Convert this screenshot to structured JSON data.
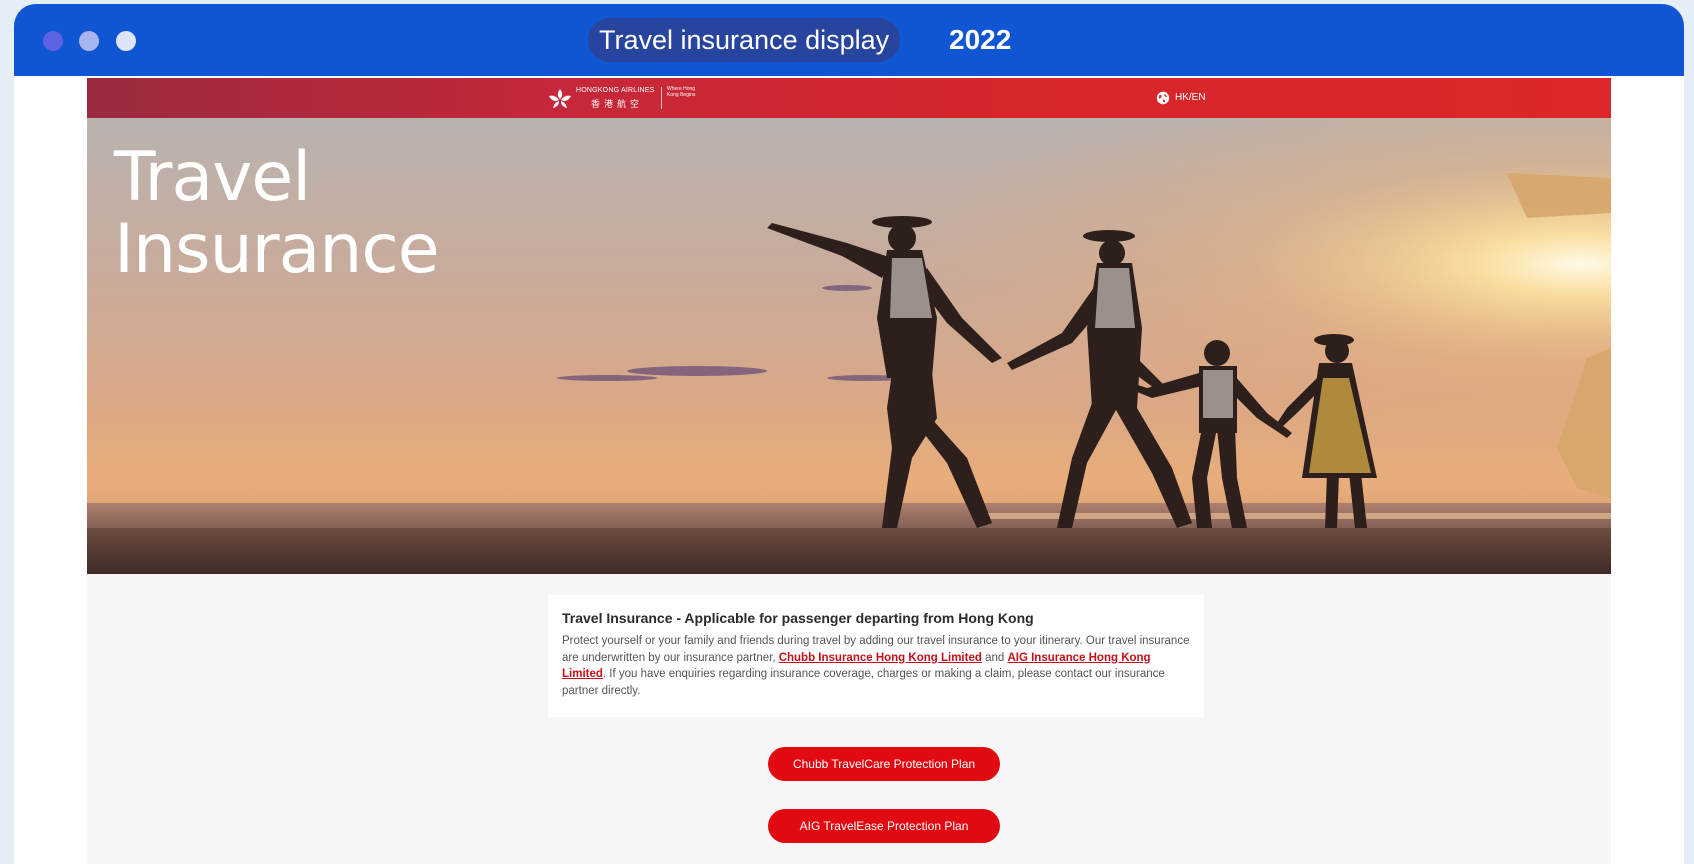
{
  "window": {
    "title": "Travel insurance display",
    "year": "2022"
  },
  "navbar": {
    "logo_en": "HONGKONG AIRLINES",
    "logo_cn": "香港航空",
    "logo_tagline": "Where Hong Kong Begins",
    "locale_label": "HK/EN",
    "locale_icon": "globe-icon"
  },
  "hero": {
    "title_line1": "Travel",
    "title_line2": "Insurance"
  },
  "info": {
    "heading": "Travel Insurance - Applicable for passenger departing from Hong Kong",
    "text_1": "Protect yourself or your family and friends during travel by adding our travel insurance to your itinerary. Our travel insurance are underwritten by our insurance partner, ",
    "link_chubb": "Chubb Insurance Hong Kong Limited",
    "text_2": " and ",
    "link_aig": "AIG Insurance Hong Kong Limited",
    "text_3": ". If you have enquiries regarding insurance coverage, charges or making a claim, please contact our insurance partner directly."
  },
  "buttons": {
    "chubb_plan": "Chubb TravelCare Protection Plan",
    "aig_plan": "AIG TravelEase Protection Plan"
  },
  "colors": {
    "titlebar": "#1055d2",
    "brand_red": "#e10a13",
    "link_red": "#c4101a"
  }
}
